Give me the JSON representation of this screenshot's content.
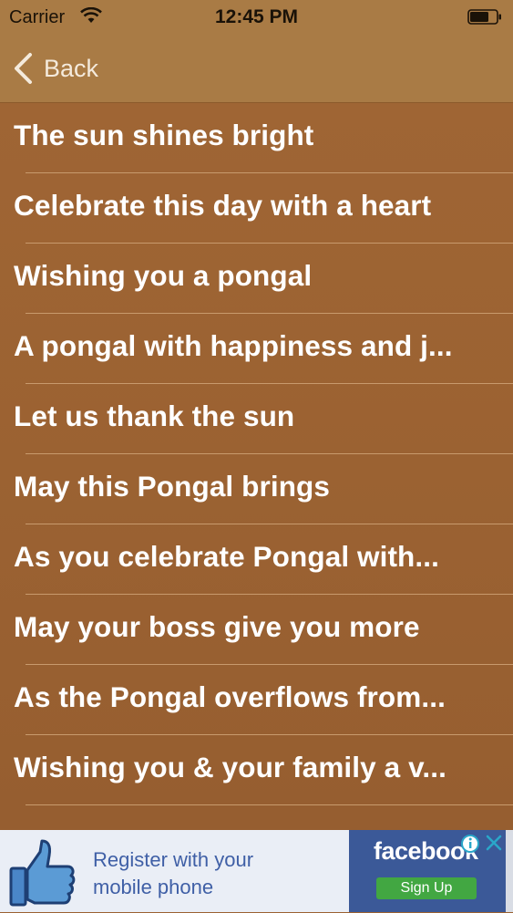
{
  "status_bar": {
    "carrier": "Carrier",
    "time": "12:45 PM"
  },
  "nav": {
    "back_label": "Back"
  },
  "items": [
    "The sun shines bright",
    "Celebrate this day with a heart",
    "Wishing you a pongal",
    "A pongal with happiness and j...",
    "Let us thank the sun",
    "May this Pongal brings",
    "As you celebrate Pongal with...",
    "May your boss give you more",
    "As the Pongal overflows from...",
    "Wishing you & your family a v..."
  ],
  "ad": {
    "line1": "Register with your",
    "line2": "mobile phone",
    "brand": "facebook",
    "cta": "Sign Up"
  },
  "colors": {
    "background": "#9b6232",
    "navbar": "#a97b45",
    "separator": "#c89a6d",
    "facebook_blue": "#3b5998",
    "signup_green": "#42a742"
  }
}
